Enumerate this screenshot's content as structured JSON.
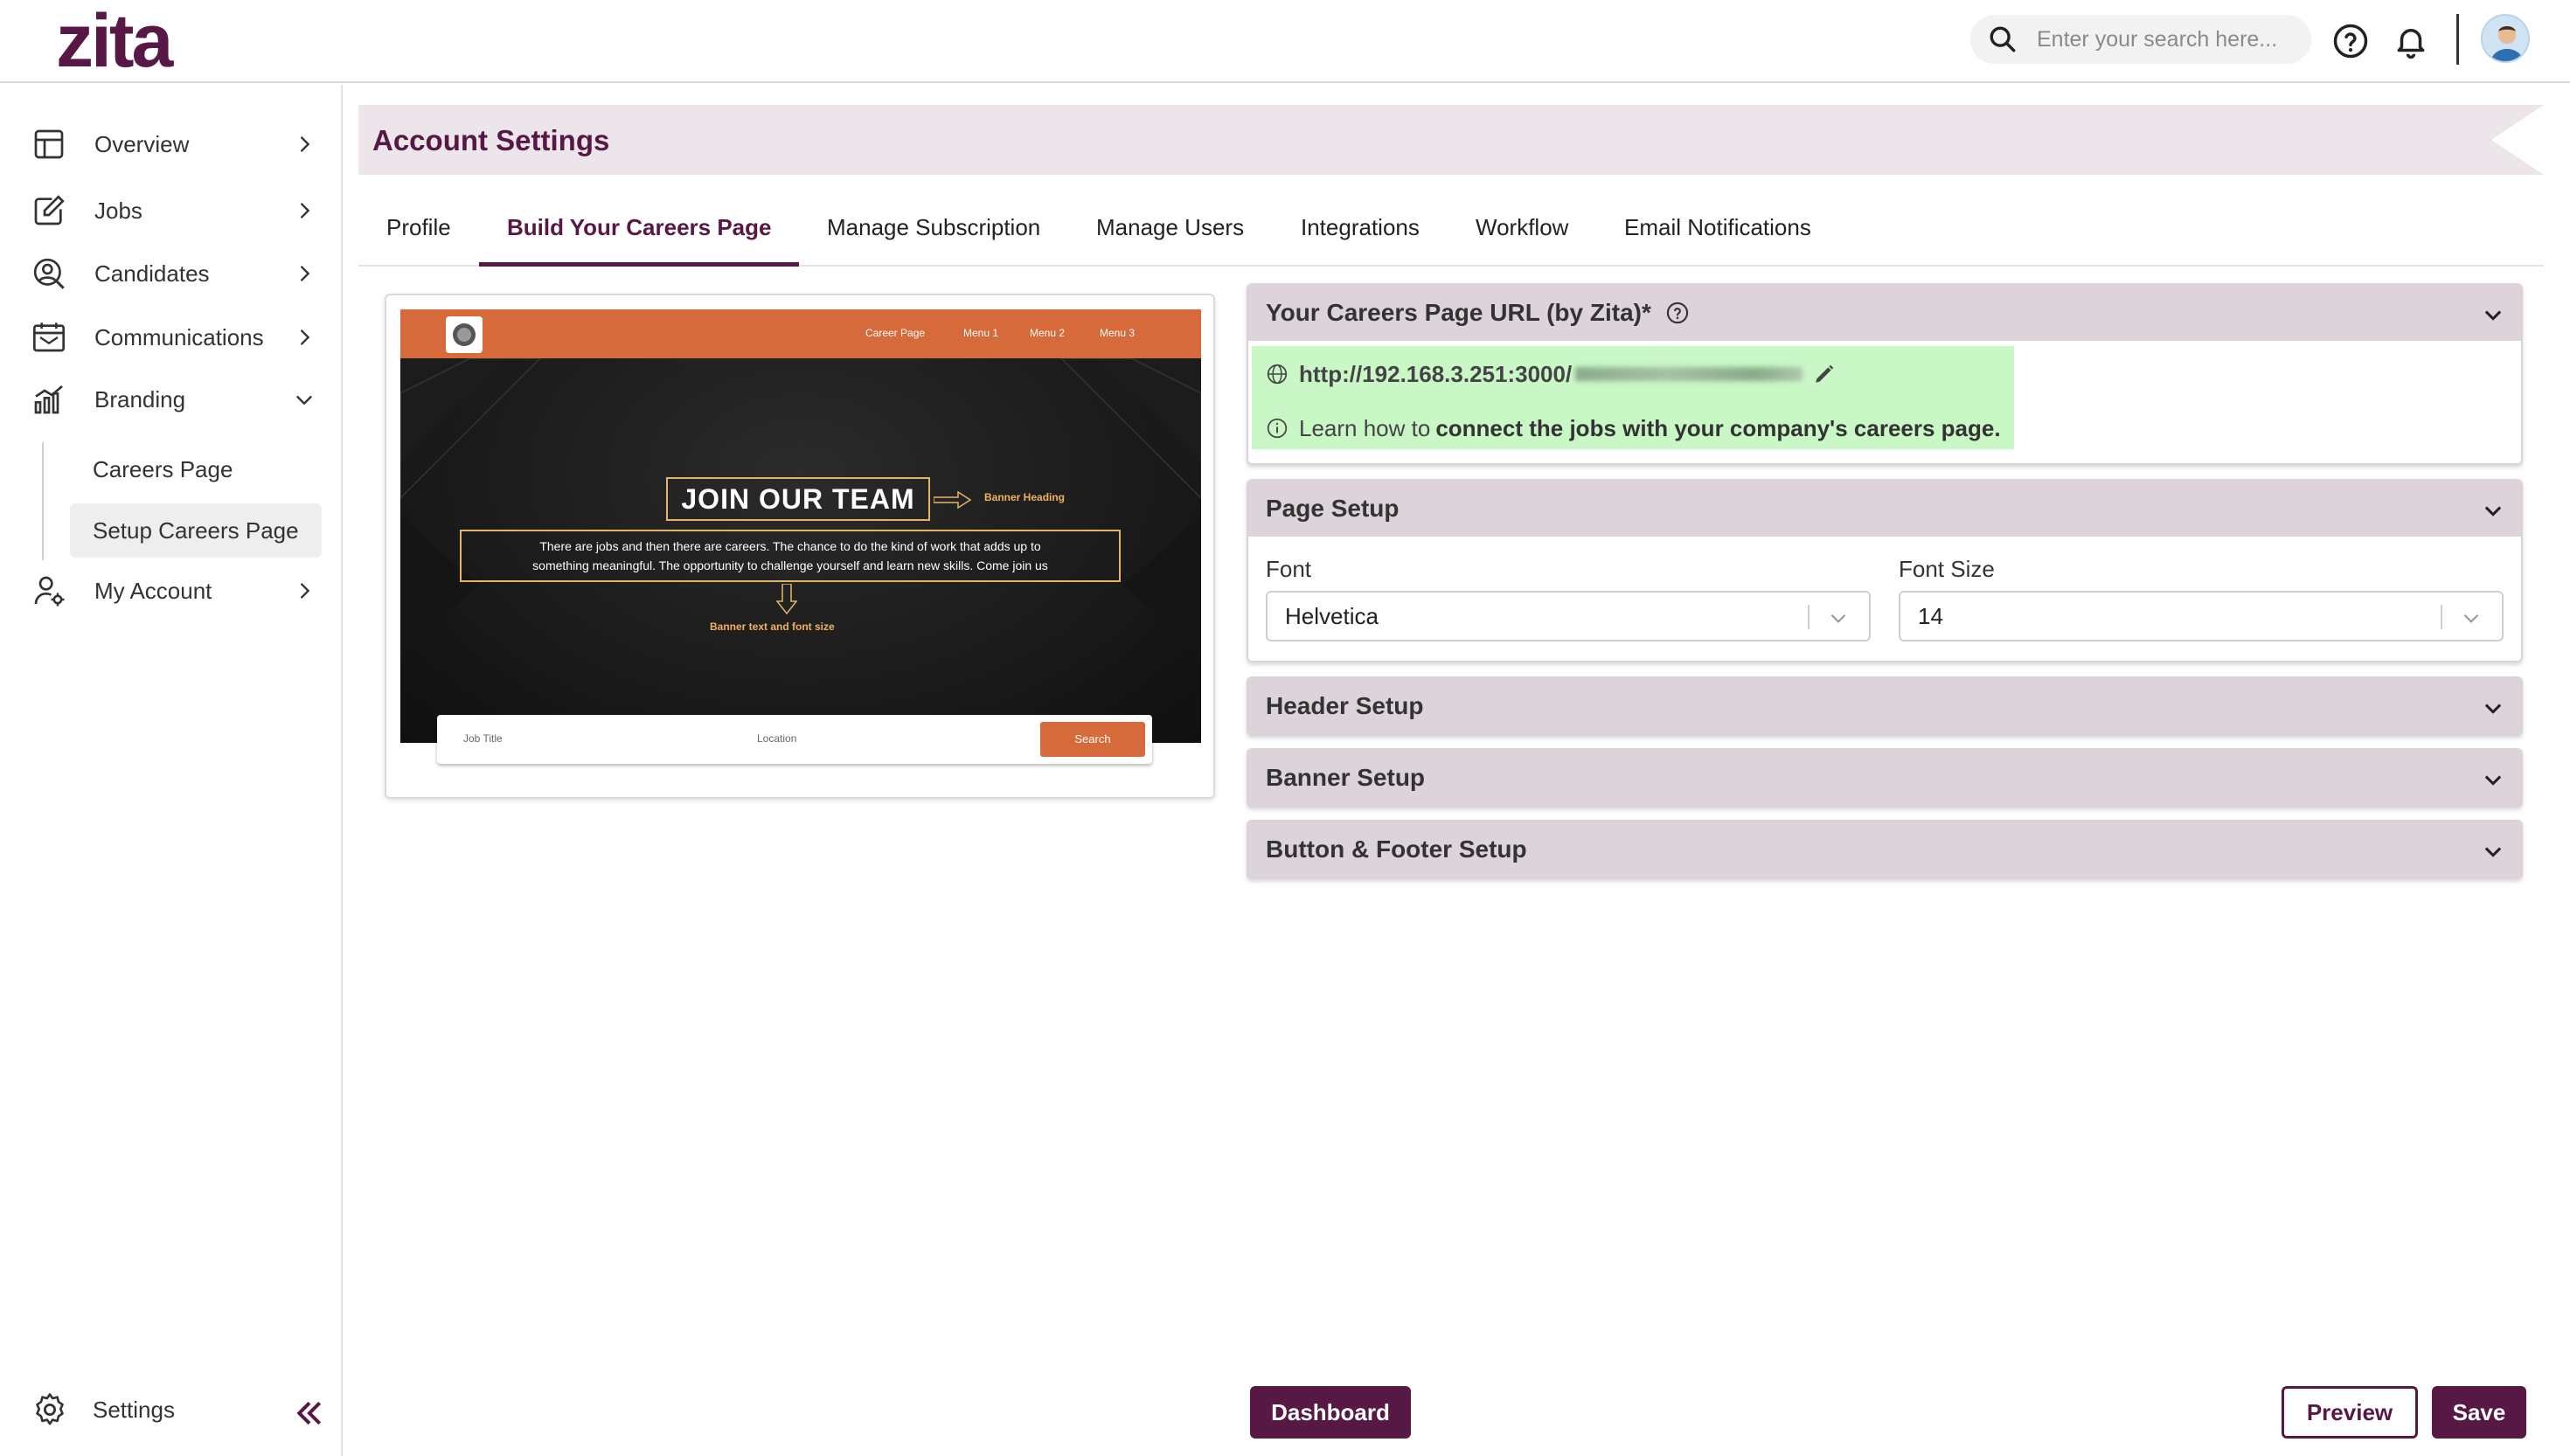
{
  "app": {
    "logo": "zita"
  },
  "topbar": {
    "search_placeholder": "Enter your search here...",
    "icons": [
      "search-icon",
      "help-icon",
      "bell-icon",
      "avatar"
    ]
  },
  "sidebar": {
    "items": [
      {
        "label": "Overview",
        "icon": "overview-icon"
      },
      {
        "label": "Jobs",
        "icon": "jobs-icon"
      },
      {
        "label": "Candidates",
        "icon": "candidates-icon"
      },
      {
        "label": "Communications",
        "icon": "communications-icon"
      },
      {
        "label": "Branding",
        "icon": "branding-icon"
      },
      {
        "label": "My Account",
        "icon": "account-icon"
      }
    ],
    "branding_sub": [
      "Careers Page",
      "Setup Careers Page"
    ],
    "active_sub": "Setup Careers Page",
    "settings_label": "Settings"
  },
  "page": {
    "title": "Account Settings",
    "tabs": [
      "Profile",
      "Build Your Careers Page",
      "Manage Subscription",
      "Manage Users",
      "Integrations",
      "Workflow",
      "Email Notifications"
    ],
    "active_tab": "Build Your Careers Page"
  },
  "preview": {
    "menus": [
      "Career Page",
      "Menu 1",
      "Menu 2",
      "Menu 3"
    ],
    "heading": "JOIN OUR TEAM",
    "heading_annotation": "Banner Heading",
    "text_line1": "There are jobs and then there are careers. The chance to do the kind of work that adds up to",
    "text_line2": "something meaningful. The opportunity to challenge yourself and learn new skills. Come join us",
    "text_annotation": "Banner text and font size",
    "search_job": "Job Title",
    "search_location": "Location",
    "search_button": "Search"
  },
  "url_panel": {
    "title": "Your Careers Page URL (by Zita)*",
    "url": "http://192.168.3.251:3000/",
    "learn_prefix": "Learn how to",
    "learn_link": "connect the jobs with your company's careers page."
  },
  "page_setup": {
    "title": "Page Setup",
    "font_label": "Font",
    "font_value": "Helvetica",
    "size_label": "Font Size",
    "size_value": "14"
  },
  "sections": [
    "Header Setup",
    "Banner Setup",
    "Button & Footer Setup"
  ],
  "buttons": {
    "dashboard": "Dashboard",
    "preview": "Preview",
    "save": "Save"
  },
  "colors": {
    "brand": "#581845",
    "accent_orange": "#d66a3a",
    "url_highlight": "#c9f7c6",
    "panel_header": "#ddd3db"
  }
}
